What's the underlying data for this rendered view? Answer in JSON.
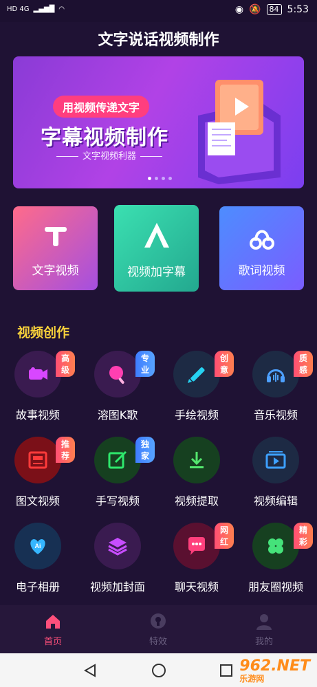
{
  "status": {
    "net": "HD 4G",
    "battery": "84",
    "time": "5:53"
  },
  "app": {
    "title": "文字说话视频制作"
  },
  "banner": {
    "tag": "用视频传递文字",
    "headline": "字幕视频制作",
    "sub": "文字视频利器",
    "slides": 4,
    "active": 0
  },
  "cards": [
    {
      "label": "文字视频",
      "icon": "text-t-icon",
      "gradient": [
        "#ff6b8a",
        "#a44fe0"
      ]
    },
    {
      "label": "视频加字幕",
      "icon": "letter-a-icon",
      "gradient": [
        "#3be0b1",
        "#23a88f"
      ]
    },
    {
      "label": "歌词视频",
      "icon": "music-note-icon",
      "gradient": [
        "#4d8dff",
        "#7a5dff"
      ]
    }
  ],
  "section": {
    "title": "视频创作"
  },
  "grid": [
    [
      {
        "label": "故事视频",
        "icon": "camera-icon",
        "badge": "高级",
        "badge_color": "pink",
        "icon_color": "#d847ff",
        "bg": "#3a1b50"
      },
      {
        "label": "溶图K歌",
        "icon": "ktv-icon",
        "badge": "专业",
        "badge_color": "blue",
        "icon_color": "#ff3fb1",
        "bg": "#3a1b50"
      },
      {
        "label": "手绘视频",
        "icon": "pencil-icon",
        "badge": "创意",
        "badge_color": "pink",
        "icon_color": "#26d2f2",
        "bg": "#1d2a44"
      },
      {
        "label": "音乐视频",
        "icon": "headphones-icon",
        "badge": "质感",
        "badge_color": "pink",
        "icon_color": "#4da0ff",
        "bg": "#1d2a44"
      }
    ],
    [
      {
        "label": "图文视频",
        "icon": "article-icon",
        "badge": "推荐",
        "badge_color": "pink",
        "icon_color": "#ff3a3a",
        "bg": "#7b1018"
      },
      {
        "label": "手写视频",
        "icon": "edit-icon",
        "badge": "独家",
        "badge_color": "blue",
        "icon_color": "#2ee86c",
        "bg": "#164020"
      },
      {
        "label": "视频提取",
        "icon": "download-icon",
        "badge": "",
        "badge_color": "",
        "icon_color": "#54e86e",
        "bg": "#164020"
      },
      {
        "label": "视频编辑",
        "icon": "video-edit-icon",
        "badge": "",
        "badge_color": "",
        "icon_color": "#3da0ff",
        "bg": "#1d2a44"
      }
    ],
    [
      {
        "label": "电子相册",
        "icon": "heart-ai-icon",
        "badge": "",
        "badge_color": "",
        "icon_color": "#35b6ff",
        "bg": "#173053"
      },
      {
        "label": "视频加封面",
        "icon": "layers-icon",
        "badge": "",
        "badge_color": "",
        "icon_color": "#c74dff",
        "bg": "#3a1b50"
      },
      {
        "label": "聊天视频",
        "icon": "chat-icon",
        "badge": "网红",
        "badge_color": "pink",
        "icon_color": "#ff3f7c",
        "bg": "#5a1030"
      },
      {
        "label": "朋友圈视频",
        "icon": "clover-icon",
        "badge": "精彩",
        "badge_color": "pink",
        "icon_color": "#45e27a",
        "bg": "#164020"
      }
    ]
  ],
  "nav": [
    {
      "label": "首页",
      "icon": "home-icon",
      "active": true
    },
    {
      "label": "特效",
      "icon": "lightbulb-icon",
      "active": false
    },
    {
      "label": "我的",
      "icon": "user-icon",
      "active": false
    }
  ],
  "watermark": {
    "text": "962.NET",
    "sub": "乐游网"
  }
}
